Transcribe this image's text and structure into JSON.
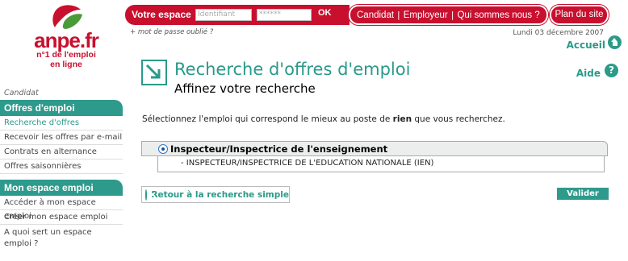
{
  "logo": {
    "name": "anpe.fr",
    "tagline_line1": "n°1 de l'emploi",
    "tagline_line2": "en ligne"
  },
  "topbar": {
    "espace_label": "Votre espace",
    "identifiant_placeholder": "Identifiant",
    "password_value": "******",
    "ok_label": "OK",
    "nav": [
      "Candidat",
      "Employeur",
      "Qui sommes nous ?"
    ],
    "plan_label": "Plan du site"
  },
  "forgot_password": "+ mot de passe oublié ?",
  "date": "Lundi 03 décembre 2007",
  "accueil": "Accueil",
  "sidebar": {
    "category": "Candidat",
    "section1_title": "Offres d'emploi",
    "section1_items": [
      "Recherche d'offres",
      "Recevoir les offres par e-mail",
      "Contrats en alternance",
      "Offres saisonnières"
    ],
    "section2_title": "Mon espace emploi",
    "section2_items": [
      "Accéder à mon espace emploi",
      "Créer mon espace emploi"
    ],
    "section2_double_line1": "A quoi sert un espace",
    "section2_double_line2": "emploi ?"
  },
  "main": {
    "title": "Recherche d'offres d'emploi",
    "subtitle": "Affinez votre recherche",
    "aide": "Aide",
    "instruction_before": "Sélectionnez l'emploi qui correspond le mieux au poste de ",
    "instruction_bold": "rien",
    "instruction_after": " que vous recherchez.",
    "result_title": "Inspecteur/Inspectrice de l'enseignement",
    "result_sub": "- INSPECTEUR/INSPECTRICE DE L'EDUCATION NATIONALE (IEN)",
    "back_label": "Retour à la recherche simple",
    "valider_label": "Valider"
  },
  "colors": {
    "brand_red": "#c8102e",
    "brand_teal": "#2a9a8a"
  }
}
